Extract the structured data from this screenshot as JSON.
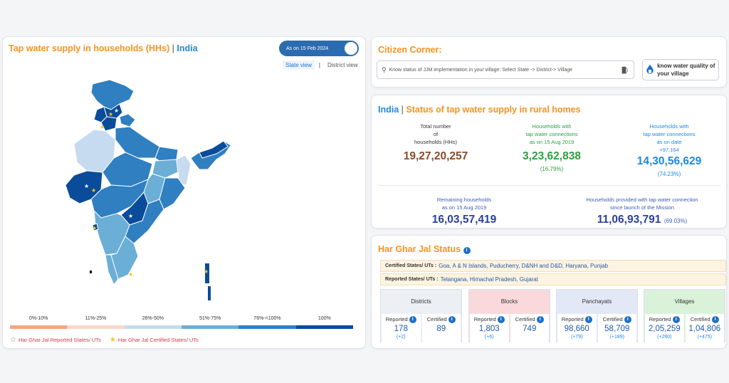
{
  "map": {
    "title_part1": "Tap water supply in households (HHs)",
    "title_sep": "|",
    "title_part2": "India",
    "toggle_label": "As on 15 Feb 2024",
    "state_view": "State view",
    "district_view": "District view",
    "view_sep": "|",
    "legend": [
      "0%-10%",
      "11%-25%",
      "26%-50%",
      "51%-75%",
      "76%-<100%",
      "100%"
    ],
    "legend_colors": [
      "#f4a582",
      "#fbd6c7",
      "#c6dbef",
      "#6baed6",
      "#2f7fc1",
      "#0a4c9a"
    ],
    "key_reported": "Har Ghar Jal Reported States/ UTs",
    "key_certified": "Har Ghar Jal Certified States/ UTs"
  },
  "citizen": {
    "title": "Citizen Corner:",
    "search_placeholder": "Know status of JJM implementation in your village: Select State -> District-> Village",
    "water_quality_btn": "know water quality of your village"
  },
  "status": {
    "title_part1": "India",
    "title_sep": "|",
    "title_part2": "Status of tap water supply in rural homes",
    "total_label_1": "Total number",
    "total_label_2": "of",
    "total_label_3": "households (HHs)",
    "total_value": "19,27,20,257",
    "hh2019_label_1": "Households with",
    "hh2019_label_2": "tap water connections",
    "hh2019_label_3": "as on 15 Aug 2019",
    "hh2019_value": "3,23,62,838",
    "hh2019_pct": "(16.79%)",
    "hhnow_label_1": "Households with",
    "hhnow_label_2": "tap water connections",
    "hhnow_label_3": "as on date",
    "hhnow_delta": "+97,164",
    "hhnow_value": "14,30,56,629",
    "hhnow_pct": "(74.23%)",
    "remaining_label_1": "Remaining households",
    "remaining_label_2": "as on 15 Aug 2019",
    "remaining_value": "16,03,57,419",
    "provided_label_1": "Households provided with tap water connection",
    "provided_label_2": "since launch of the Mission",
    "provided_value": "11,06,93,791",
    "provided_pct": "(69.03%)"
  },
  "hgj": {
    "title": "Har Ghar Jal Status",
    "certified_label": "Certified States/ UTs :",
    "certified_value": "Goa, A & N Islands, Puducherry, D&NH and D&D, Haryana, Punjab",
    "reported_label": "Reported States/ UTs :",
    "reported_value": "Telangana, Himachal Pradesh, Gujarat",
    "reported_col": "Reported",
    "certified_col": "Certified",
    "tiles": [
      {
        "name": "Districts",
        "reported": "178",
        "reported_delta": "(+2)",
        "certified": "89",
        "certified_delta": "",
        "color": "#eceff3"
      },
      {
        "name": "Blocks",
        "reported": "1,803",
        "reported_delta": "(+6)",
        "certified": "749",
        "certified_delta": "",
        "color": "#f9d9dc"
      },
      {
        "name": "Panchayats",
        "reported": "98,660",
        "reported_delta": "(+79)",
        "certified": "58,709",
        "certified_delta": "(+189)",
        "color": "#e3e8f7"
      },
      {
        "name": "Villages",
        "reported": "2,05,259",
        "reported_delta": "(+260)",
        "certified": "1,04,806",
        "certified_delta": "(+475)",
        "color": "#d9f2d9"
      }
    ]
  }
}
